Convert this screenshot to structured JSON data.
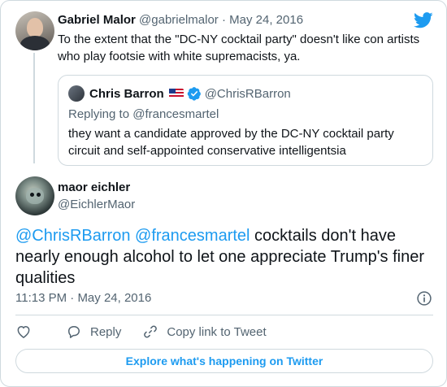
{
  "parent_tweet": {
    "author_name": "Gabriel Malor",
    "handle": "@gabrielmalor",
    "separator": "·",
    "date": "May 24, 2016",
    "text": "To the extent that the \"DC-NY cocktail party\" doesn't like con artists who play footsie with white supremacists, ya."
  },
  "quoted_tweet": {
    "author_name": "Chris Barron",
    "flag": "🇺🇸",
    "handle": "@ChrisRBarron",
    "replying_to": "Replying to @francesmartel",
    "text": "they want a candidate approved by the DC-NY cocktail party circuit and self-appointed conservative intelligentsia"
  },
  "main_tweet": {
    "author_name": "maor eichler",
    "handle": "@EichlerMaor",
    "mention_1": "@ChrisRBarron",
    "mention_2": "@francesmartel",
    "text": "cocktails don't have nearly enough alcohol to let one appreciate Trump's finer qualities",
    "time": "11:13 PM",
    "separator": "·",
    "date": "May 24, 2016"
  },
  "actions": {
    "like_icon": "heart-icon",
    "reply_label": "Reply",
    "reply_icon": "speech-bubble-icon",
    "copy_label": "Copy link to Tweet",
    "copy_icon": "link-icon"
  },
  "footer": {
    "explore_label": "Explore what's happening on Twitter"
  },
  "icons": {
    "brand": "twitter-bird-icon",
    "info": "info-icon",
    "verified": "verified-badge-icon"
  },
  "colors": {
    "accent": "#1d9bf0",
    "text": "#0f1419",
    "muted": "#536471",
    "border": "#cfd9de"
  }
}
